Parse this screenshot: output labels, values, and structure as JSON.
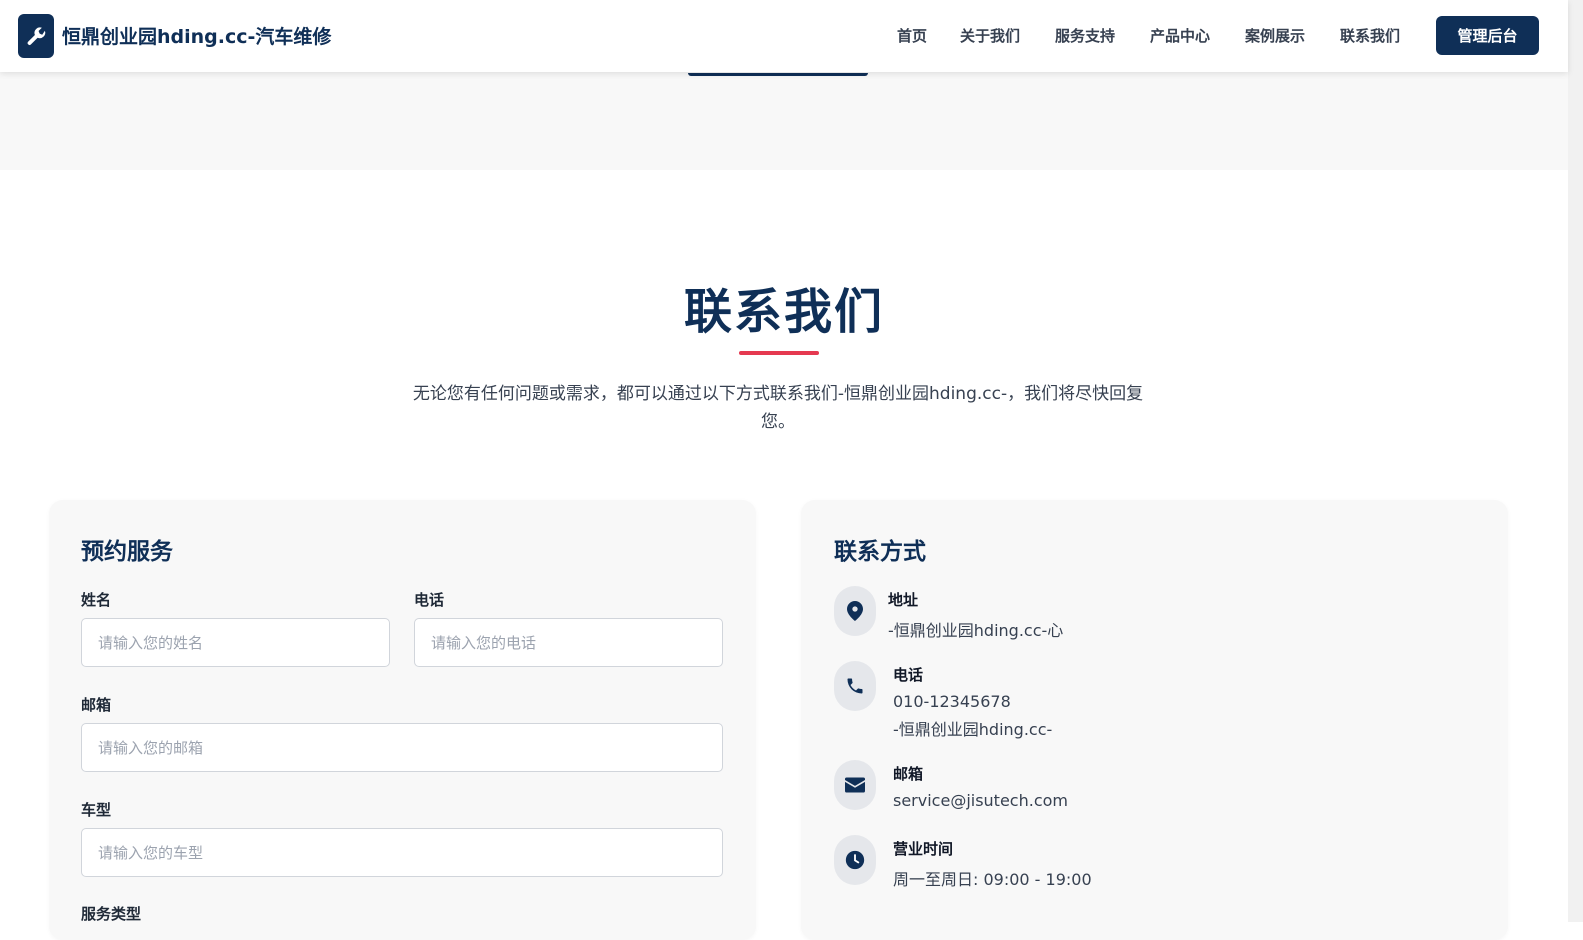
{
  "header": {
    "logo_text": "恒鼎创业园hding.cc-汽车维修",
    "nav": [
      "首页",
      "关于我们",
      "服务支持",
      "产品中心",
      "案例展示",
      "联系我们"
    ],
    "admin_button": "管理后台"
  },
  "contact_section": {
    "title": "联系我们",
    "description": "无论您有任何问题或需求，都可以通过以下方式联系我们-恒鼎创业园hding.cc-，我们将尽快回复您。"
  },
  "booking_form": {
    "title": "预约服务",
    "name_label": "姓名",
    "name_placeholder": "请输入您的姓名",
    "phone_label": "电话",
    "phone_placeholder": "请输入您的电话",
    "email_label": "邮箱",
    "email_placeholder": "请输入您的邮箱",
    "car_label": "车型",
    "car_placeholder": "请输入您的车型",
    "service_label": "服务类型"
  },
  "contact_info": {
    "title": "联系方式",
    "address_label": "地址",
    "address_value": "-恒鼎创业园hding.cc-心",
    "phone_label": "电话",
    "phone_value": "010-12345678",
    "phone_note": "-恒鼎创业园hding.cc-",
    "email_label": "邮箱",
    "email_value": "service@jisutech.com",
    "hours_label": "营业时间",
    "hours_value": "周一至周日: 09:00 - 19:00"
  },
  "colors": {
    "primary": "#0f2f57",
    "accent": "#e53950",
    "background_gray": "#f8f8f8"
  },
  "icons": [
    "wrench-icon",
    "map-pin-icon",
    "phone-icon",
    "envelope-icon",
    "clock-icon"
  ]
}
